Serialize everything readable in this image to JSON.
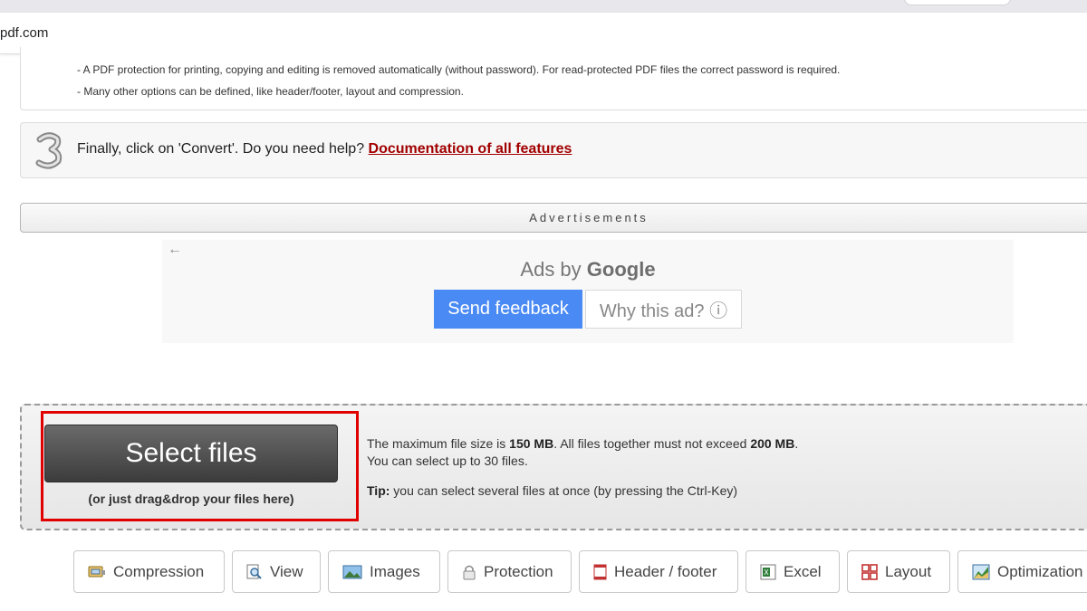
{
  "browser": {
    "url_fragment": "pdf.com"
  },
  "info": {
    "line1": "- A PDF protection for printing, copying and editing is removed automatically (without password). For read-protected PDF files the correct password is required.",
    "line2": "- Many other options can be defined, like header/footer, layout and compression."
  },
  "step3": {
    "number": "3",
    "text": "Finally, click on 'Convert'. Do you need help? ",
    "link": "Documentation of all features"
  },
  "ads": {
    "label": "Advertisements",
    "back": "←",
    "ads_by": "Ads by",
    "google": "Google",
    "feedback_label": "Send feedback",
    "why_label": "Why this ad? ⓘ"
  },
  "upload": {
    "select_label": "Select files",
    "drag_hint": "(or just drag&drop your files here)",
    "max_prefix": "The maximum file size is ",
    "max_single": "150 MB",
    "max_mid": ". All files together must not exceed ",
    "max_total": "200 MB",
    "max_end": ".",
    "limit_text": "You can select up to 30 files.",
    "tip_label": "Tip:",
    "tip_text": " you can select several files at once (by pressing the Ctrl-Key)"
  },
  "toolbar": {
    "compression": "Compression",
    "view": "View",
    "images": "Images",
    "protection": "Protection",
    "header_footer": "Header / footer",
    "excel": "Excel",
    "layout": "Layout",
    "optimization": "Optimization"
  },
  "colors": {
    "accent_red": "#a10000",
    "highlight": "#e00000",
    "feedback_blue": "#4a8af4"
  }
}
